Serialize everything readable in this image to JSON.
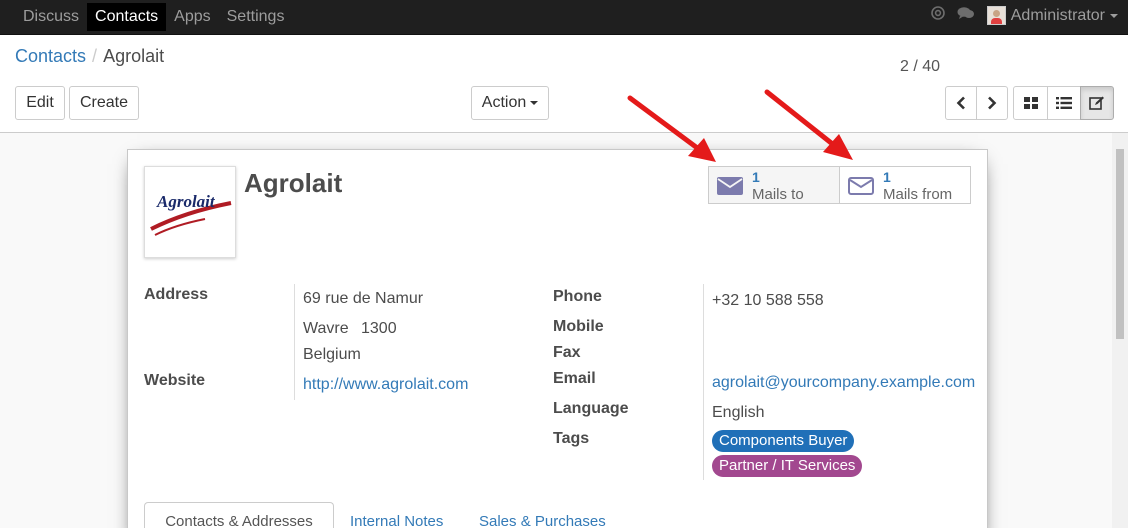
{
  "navbar": {
    "menu": [
      "Discuss",
      "Contacts",
      "Apps",
      "Settings"
    ],
    "user": "Administrator"
  },
  "breadcrumb": {
    "parent": "Contacts",
    "current": "Agrolait"
  },
  "buttons": {
    "edit": "Edit",
    "create": "Create",
    "action": "Action"
  },
  "pager": {
    "text": "2 / 40"
  },
  "record": {
    "name": "Agrolait",
    "logo_text": "Agrolait",
    "stats": [
      {
        "count": "1",
        "label": "Mails to"
      },
      {
        "count": "1",
        "label": "Mails from"
      }
    ]
  },
  "fields": {
    "address_label": "Address",
    "street": "69 rue de Namur",
    "city": "Wavre",
    "zip": "1300",
    "country": "Belgium",
    "website_label": "Website",
    "website": "http://www.agrolait.com",
    "phone_label": "Phone",
    "phone": "+32 10 588 558",
    "mobile_label": "Mobile",
    "fax_label": "Fax",
    "email_label": "Email",
    "email": "agrolait@yourcompany.example.com",
    "language_label": "Language",
    "language": "English",
    "tags_label": "Tags",
    "tags": [
      "Components Buyer",
      "Partner / IT Services"
    ]
  },
  "tabs": [
    "Contacts & Addresses",
    "Internal Notes",
    "Sales & Purchases"
  ],
  "colors": {
    "link": "#337ab7",
    "tag_blue": "#2070b8",
    "tag_purple": "#a2488f",
    "annotation_arrow": "#e41a1a"
  },
  "icons": [
    "at-icon",
    "chat-icon",
    "envelope-icon",
    "kanban-view-icon",
    "list-view-icon",
    "form-view-icon",
    "chevron-left-icon",
    "chevron-right-icon"
  ]
}
